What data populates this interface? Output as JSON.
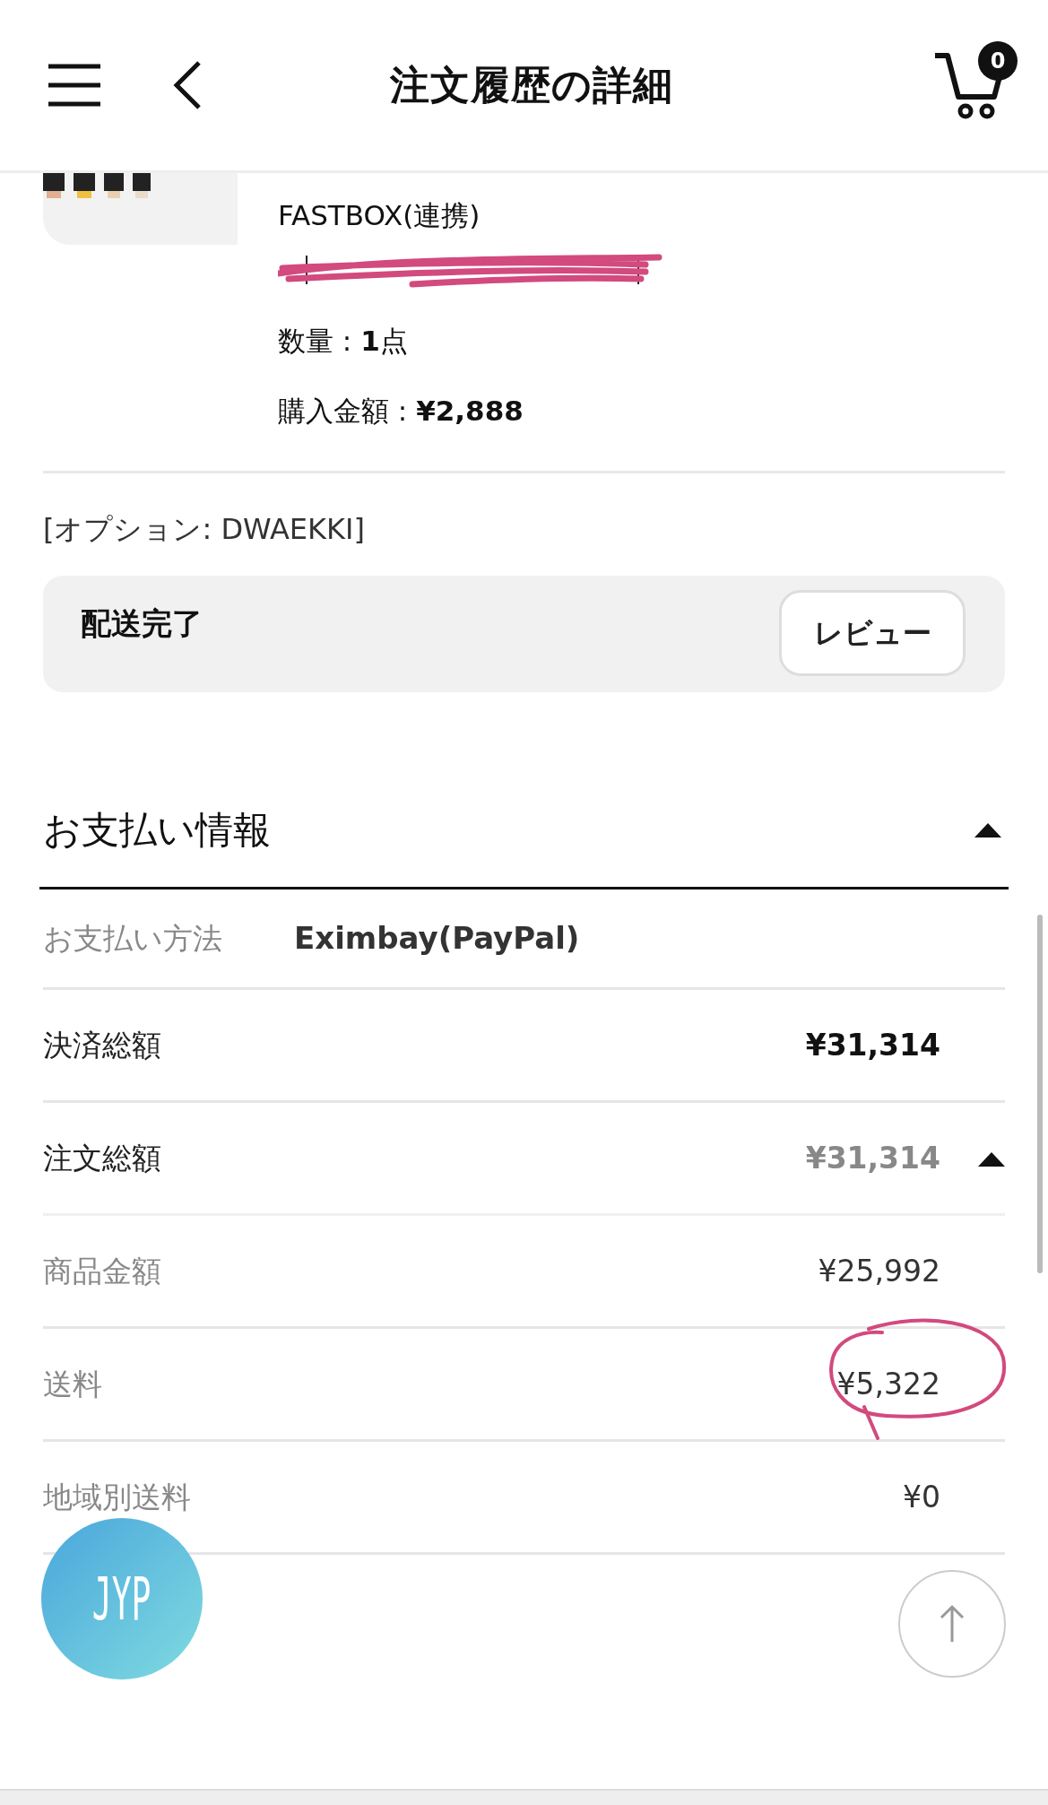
{
  "header": {
    "title": "注文履歴の詳細",
    "cart_count": "0"
  },
  "product": {
    "kind": "picture",
    "shipping": "FASTBOX(連携)",
    "redacted": true,
    "quantity": "数量 : **1**点",
    "amount": "購入金額 : **¥2,888**"
  },
  "option": "[オプション: DWAEKKI]",
  "status": {
    "label": "配送完了",
    "button": "レビュー"
  },
  "payment": {
    "title": "お支払い情報",
    "expanded": true,
    "rows": [
      {
        "kind": "method",
        "label": "お支払い方法",
        "value": "Eximbay(PayPal)"
      },
      {
        "kind": "total",
        "label": "決済総額",
        "value": "¥31,314"
      },
      {
        "kind": "group",
        "label": "注文総額",
        "value": "¥31,314",
        "expanded": true
      },
      {
        "kind": "sub",
        "label": "商品金額",
        "value": "¥25,992",
        "circled": false
      },
      {
        "kind": "sub",
        "label": "送料",
        "value": "¥5,322",
        "circled": true
      },
      {
        "kind": "sub",
        "label": "地域別送料",
        "value": "¥0",
        "circled": false
      }
    ]
  },
  "floating": {
    "logo_text": "JYP"
  }
}
